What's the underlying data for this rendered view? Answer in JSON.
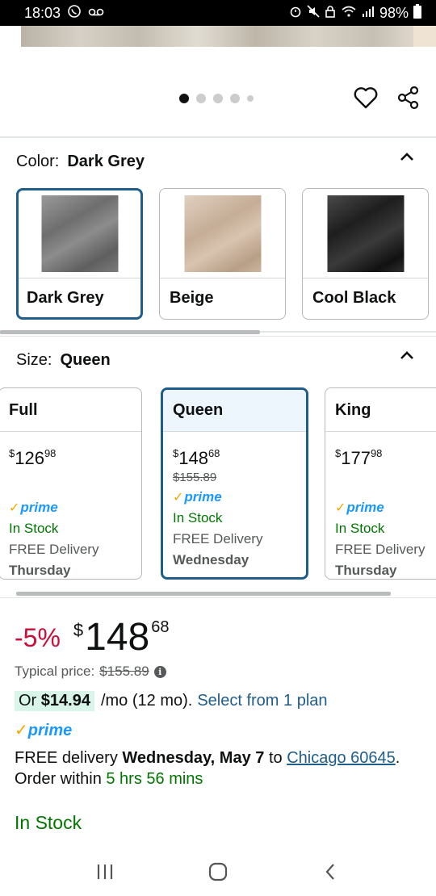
{
  "status": {
    "time": "18:03",
    "battery": "98%"
  },
  "color_section": {
    "label": "Color:",
    "selected": "Dark Grey",
    "options": [
      {
        "name": "Dark Grey",
        "swatch": "#7d7d7d"
      },
      {
        "name": "Beige",
        "swatch": "#c9b4a0"
      },
      {
        "name": "Cool Black",
        "swatch": "#2b2b2b"
      }
    ]
  },
  "size_section": {
    "label": "Size:",
    "selected": "Queen",
    "options": [
      {
        "name": "Full",
        "price_symbol": "$",
        "price_whole": "126",
        "price_frac": "98",
        "prime": "prime",
        "stock": "In Stock",
        "delivery": "FREE Delivery",
        "day": "Thursday"
      },
      {
        "name": "Queen",
        "price_symbol": "$",
        "price_whole": "148",
        "price_frac": "68",
        "list_price": "$155.89",
        "prime": "prime",
        "stock": "In Stock",
        "delivery": "FREE Delivery",
        "day": "Wednesday"
      },
      {
        "name": "King",
        "price_symbol": "$",
        "price_whole": "177",
        "price_frac": "98",
        "prime": "prime",
        "stock": "In Stock",
        "delivery": "FREE Delivery",
        "day": "Thursday"
      }
    ]
  },
  "buybox": {
    "discount": "-5%",
    "price_symbol": "$",
    "price_whole": "148",
    "price_frac": "68",
    "typical_label": "Typical price:",
    "typical_price": "$155.89",
    "plan_prefix": "Or",
    "plan_amount": "$14.94",
    "plan_term": "/mo (12 mo).",
    "plan_link": "Select from 1 plan",
    "prime": "prime",
    "delivery_prefix": "FREE delivery",
    "delivery_date": "Wednesday, May 7",
    "delivery_to": "to",
    "delivery_location": "Chicago 60645",
    "order_within_label": "Order within",
    "order_within_time": "5 hrs 56 mins",
    "stock": "In Stock"
  },
  "colors": {
    "accent_border": "#1f5d8a",
    "link": "#1f5d8a",
    "instock": "#007600",
    "discount": "#cc0c39",
    "prime_blue": "#1a98ff",
    "prime_check": "#f7a600"
  }
}
